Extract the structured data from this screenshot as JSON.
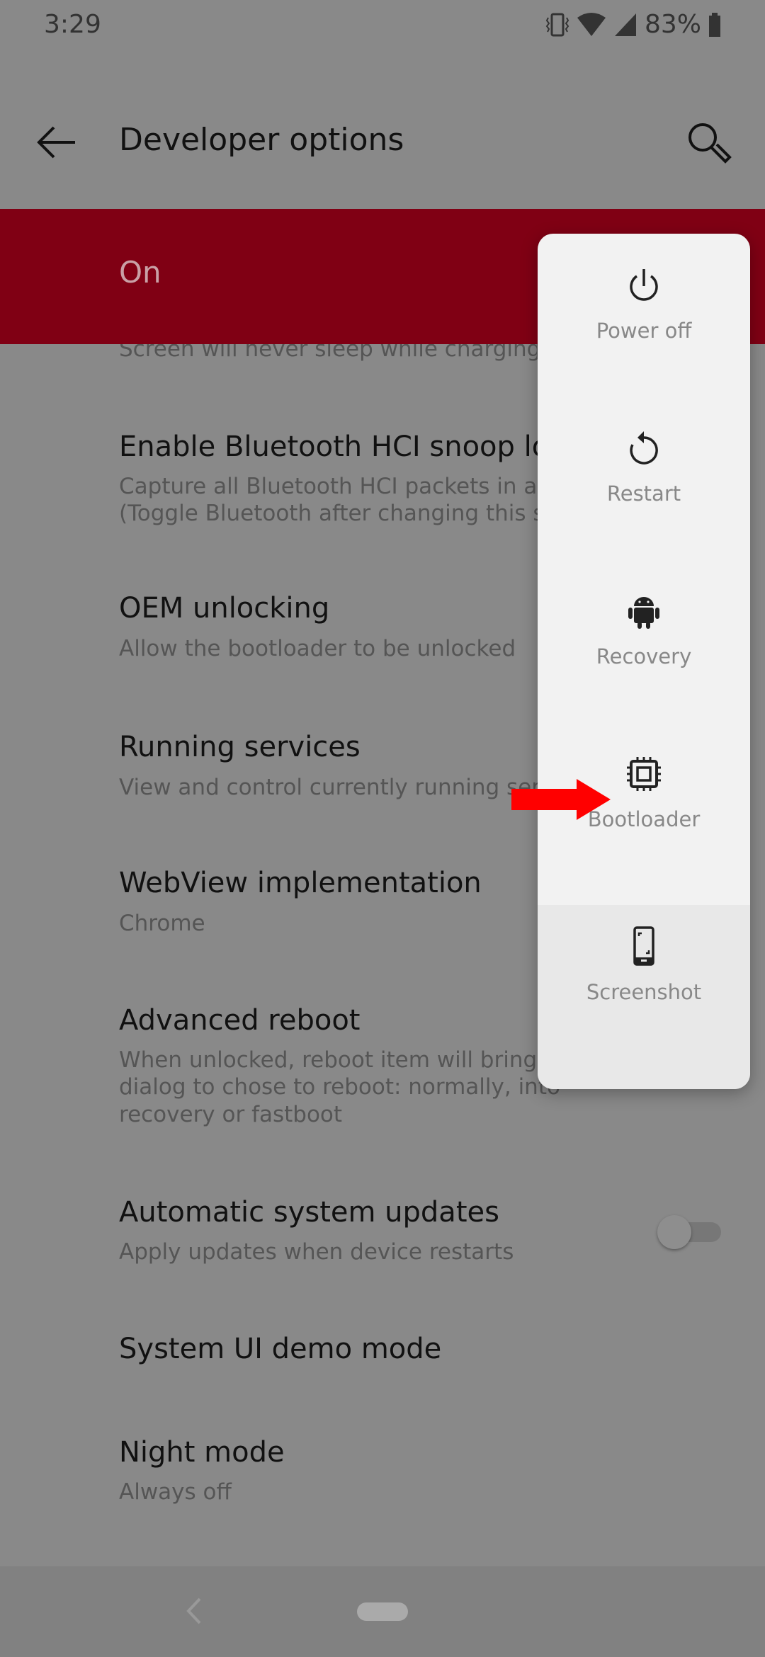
{
  "status_bar": {
    "time": "3:29",
    "battery": "83%",
    "icons": [
      "vibrate-icon",
      "wifi-icon",
      "signal-icon",
      "battery-icon"
    ]
  },
  "toolbar": {
    "title": "Developer options",
    "back_icon": "arrow-left-icon",
    "search_icon": "search-icon"
  },
  "master_switch": {
    "label": "On",
    "color": "#800014"
  },
  "settings": [
    {
      "title": "",
      "sub": [
        "Screen will never sleep while charging"
      ]
    },
    {
      "title": "Enable Bluetooth HCI snoop log",
      "sub": [
        "Capture all Bluetooth HCI packets in a file",
        "(Toggle Bluetooth after changing this setting)"
      ]
    },
    {
      "title": "OEM unlocking",
      "sub": [
        "Allow the bootloader to be unlocked"
      ]
    },
    {
      "title": "Running services",
      "sub": [
        "View and control currently running services"
      ]
    },
    {
      "title": "WebView implementation",
      "sub": [
        "Chrome"
      ]
    },
    {
      "title": "Advanced reboot",
      "sub": [
        "When unlocked, reboot item will bring up a",
        "dialog to chose to reboot: normally, into",
        "recovery or fastboot"
      ]
    },
    {
      "title": "Automatic system updates",
      "sub": [
        "Apply updates when device restarts"
      ],
      "toggle": false
    },
    {
      "title": "System UI demo mode",
      "sub": []
    },
    {
      "title": "Night mode",
      "sub": [
        "Always off"
      ]
    }
  ],
  "power_menu": [
    {
      "label": "Power off",
      "icon": "power-icon"
    },
    {
      "label": "Restart",
      "icon": "restart-icon"
    },
    {
      "label": "Recovery",
      "icon": "android-icon"
    },
    {
      "label": "Bootloader",
      "icon": "chip-icon"
    },
    {
      "label": "Screenshot",
      "icon": "phone-screenshot-icon"
    }
  ],
  "annotation": {
    "icon": "red-arrow-icon",
    "color": "#ff0000"
  }
}
